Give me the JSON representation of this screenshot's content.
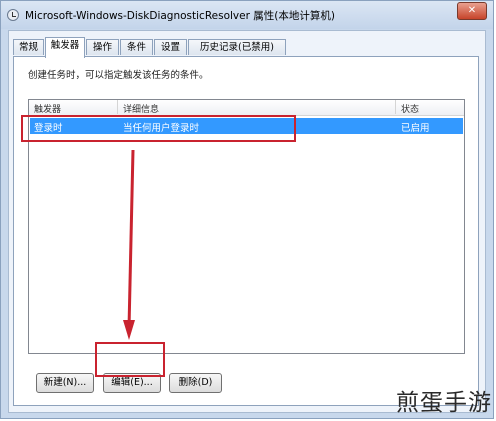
{
  "window": {
    "title": "Microsoft-Windows-DiskDiagnosticResolver 属性(本地计算机)",
    "close_glyph": "✕"
  },
  "tabs": [
    {
      "label": "常规",
      "active": false
    },
    {
      "label": "触发器",
      "active": true
    },
    {
      "label": "操作",
      "active": false
    },
    {
      "label": "条件",
      "active": false
    },
    {
      "label": "设置",
      "active": false
    },
    {
      "label": "历史记录(已禁用)",
      "active": false
    }
  ],
  "panel": {
    "description": "创建任务时，可以指定触发该任务的条件。",
    "list": {
      "columns": [
        "触发器",
        "详细信息",
        "状态"
      ],
      "rows": [
        {
          "trigger": "登录时",
          "details": "当任何用户登录时",
          "status": "已启用",
          "selected": true
        }
      ]
    },
    "buttons": {
      "new": "新建(N)...",
      "edit": "编辑(E)...",
      "delete": "删除(D)"
    }
  },
  "annotations": {
    "highlight_color": "#c9232f"
  },
  "watermark": "煎蛋手游"
}
